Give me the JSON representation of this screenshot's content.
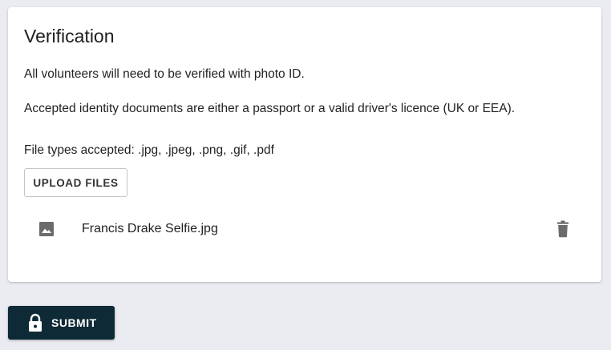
{
  "verification": {
    "title": "Verification",
    "paragraph1": "All volunteers will need to be verified with photo ID.",
    "paragraph2": "Accepted identity documents are either a passport or a valid driver's licence (UK or EEA).",
    "file_types": "File types accepted: .jpg, .jpeg, .png, .gif, .pdf",
    "upload_label": "UPLOAD FILES",
    "files": [
      {
        "name": "Francis Drake Selfie.jpg",
        "icon": "image-icon",
        "action_icon": "trash-icon"
      }
    ]
  },
  "submit": {
    "label": "SUBMIT",
    "icon": "lock-icon"
  },
  "colors": {
    "page_background": "#ebecf1",
    "card_background": "#ffffff",
    "submit_background": "#0d2a36",
    "icon_gray": "#6b6b6b"
  }
}
